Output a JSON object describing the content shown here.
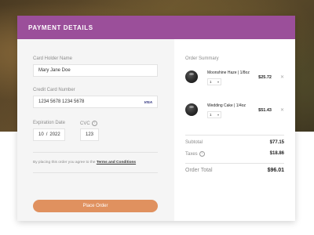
{
  "header": {
    "title": "PAYMENT DETAILS"
  },
  "colors": {
    "accent": "#9b4f9a",
    "button": "#e0915f"
  },
  "form": {
    "card_holder_label": "Card Holder Name",
    "card_holder_value": "Mary Jane Doe",
    "card_number_label": "Credit Card Number",
    "card_number_value": "1234  5678  1234  5678",
    "card_brand": "VISA",
    "expiration_label": "Expiration Date",
    "exp_month": "10",
    "exp_separator": "/",
    "exp_year": "2022",
    "cvc_label": "CVC",
    "cvc_value": "123",
    "terms_text": "By placing this order you agree to the",
    "terms_link": "Terms and Conditions",
    "submit_label": "Place Order"
  },
  "summary": {
    "title": "Order Summary",
    "items": [
      {
        "name": "Moonshine Haze | 1/8oz",
        "qty": "1",
        "price": "$25.72",
        "image_icon": "product-jar-icon"
      },
      {
        "name": "Wedding Cake | 1/4oz",
        "qty": "1",
        "price": "$51.43",
        "image_icon": "product-jar-icon"
      }
    ],
    "subtotal_label": "Subtotal",
    "subtotal_value": "$77.15",
    "taxes_label": "Taxes",
    "taxes_value": "$18.86",
    "total_label": "Order Total",
    "total_value": "$96.01"
  }
}
